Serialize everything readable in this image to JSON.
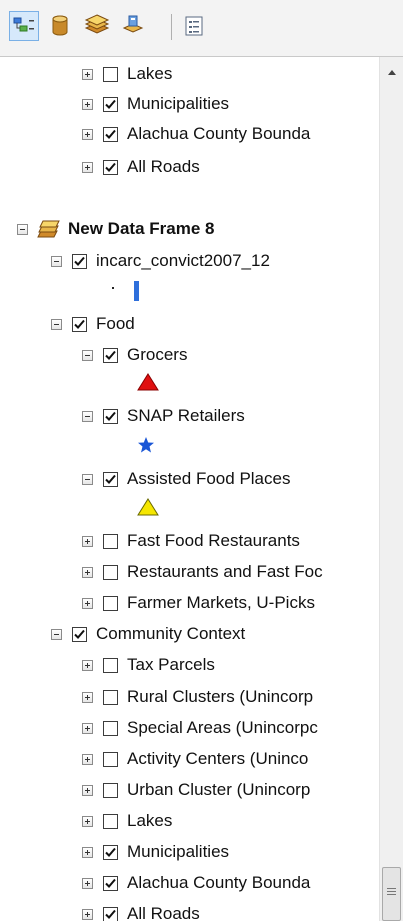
{
  "toolbar": {
    "buttons": [
      {
        "icon": "list-by-drawing-order-icon",
        "selected": true
      },
      {
        "icon": "list-by-source-icon"
      },
      {
        "icon": "list-by-visibility-icon"
      },
      {
        "icon": "list-by-selection-icon"
      },
      {
        "icon": "options-icon"
      }
    ]
  },
  "toc": {
    "rows": [
      {
        "label": "Lakes"
      },
      {
        "label": "Municipalities"
      },
      {
        "label": "Alachua County Bounda"
      },
      {
        "label": "All Roads"
      },
      {
        "label": "New Data Frame 8"
      },
      {
        "label": "incarc_convict2007_12"
      },
      {
        "label": "Food"
      },
      {
        "label": "Grocers"
      },
      {
        "label": "SNAP Retailers"
      },
      {
        "label": "Assisted Food Places"
      },
      {
        "label": "Fast Food Restaurants"
      },
      {
        "label": "Restaurants and Fast Foc"
      },
      {
        "label": "Farmer Markets, U-Picks"
      },
      {
        "label": "Community Context"
      },
      {
        "label": "Tax Parcels"
      },
      {
        "label": "Rural Clusters (Unincorp"
      },
      {
        "label": "Special Areas (Unincorpc"
      },
      {
        "label": "Activity Centers (Uninco"
      },
      {
        "label": "Urban Cluster (Unincorp"
      },
      {
        "label": "Lakes"
      },
      {
        "label": "Municipalities"
      },
      {
        "label": "Alachua County Bounda"
      },
      {
        "label": "All Roads"
      }
    ]
  },
  "colors": {
    "grocers_symbol": "#e01010",
    "snap_symbol": "#1a56d6",
    "assisted_symbol": "#f5e600",
    "incarc_symbol": "#2e6fdb",
    "toolbar_selected": "#d6e9fb"
  }
}
